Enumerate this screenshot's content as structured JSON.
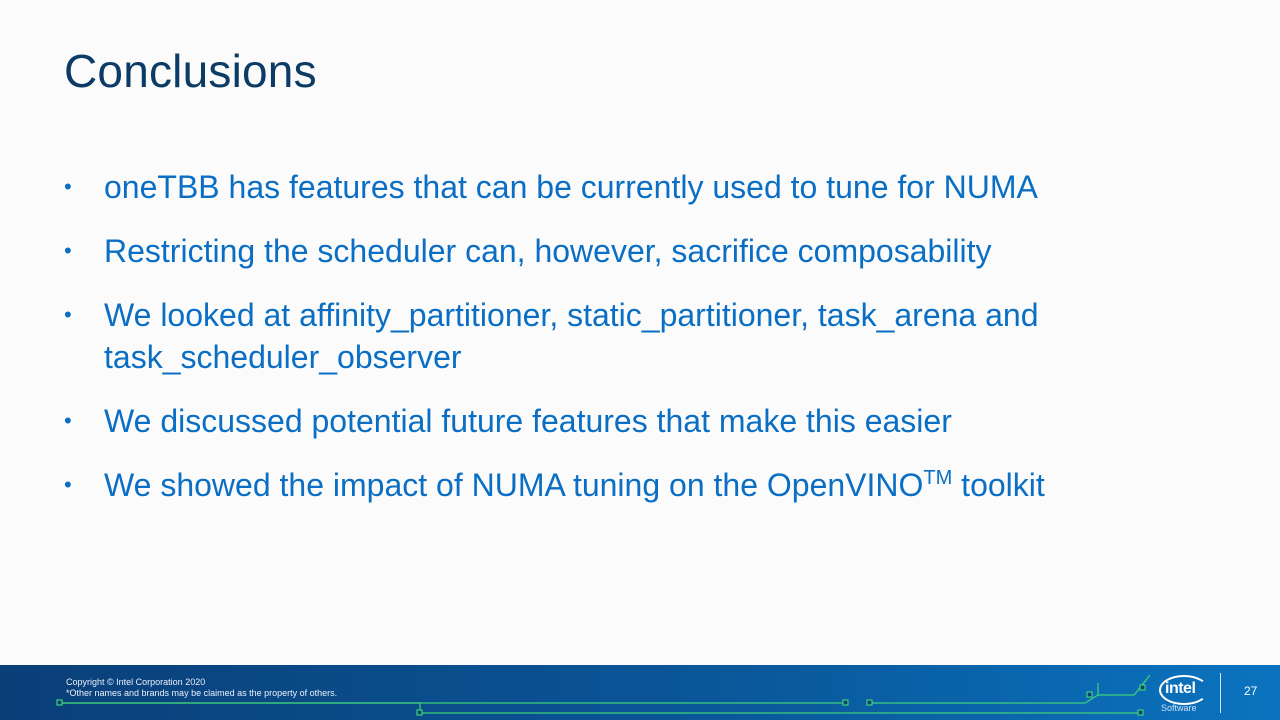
{
  "slide": {
    "title": "Conclusions",
    "bullets": [
      "oneTBB has features that can be currently used to tune for NUMA",
      "Restricting the scheduler can, however, sacrifice composability",
      "We looked at affinity_partitioner, static_partitioner, task_arena and task_scheduler_observer",
      "We discussed potential future features that make this easier"
    ],
    "last_bullet": {
      "before": "We showed the impact of NUMA tuning on the OpenVINO",
      "superscript": "TM",
      "after": " toolkit"
    },
    "bullet_symbol": "•"
  },
  "footer": {
    "copyright": "Copyright © Intel Corporation 2020",
    "disclaimer": "*Other names and brands may be claimed as the property of others.",
    "logo_text": "intel",
    "logo_subtext": "Software",
    "page_number": "27"
  },
  "colors": {
    "title": "#0c3b66",
    "bullet_text": "#0a6fc4",
    "footer_start": "#0a3f78",
    "footer_end": "#0b73bf"
  }
}
